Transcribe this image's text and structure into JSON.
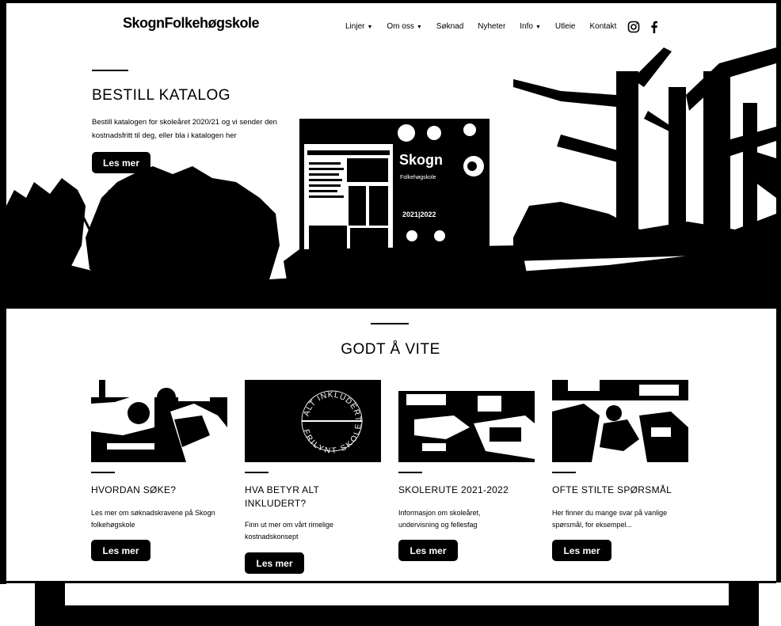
{
  "header": {
    "logo": "SkognFolkehøgskole",
    "nav": [
      {
        "label": "Linjer",
        "dropdown": true
      },
      {
        "label": "Om oss",
        "dropdown": true
      },
      {
        "label": "Søknad",
        "dropdown": false
      },
      {
        "label": "Nyheter",
        "dropdown": false
      },
      {
        "label": "Info",
        "dropdown": true
      },
      {
        "label": "Utleie",
        "dropdown": false
      },
      {
        "label": "Kontakt",
        "dropdown": false
      }
    ],
    "social": [
      "instagram-icon",
      "facebook-icon"
    ]
  },
  "hero": {
    "title": "BESTILL KATALOG",
    "text": "Bestill katalogen for skoleåret 2020/21 og vi sender den kostnadsfritt til deg, eller bla i katalogen her",
    "button": "Les mer",
    "catalog": {
      "title": "Skogn",
      "subtitle": "Folkehøgskole",
      "year": "2021|2022"
    }
  },
  "section": {
    "title": "GODT Å VITE",
    "badge_top": "ALT INKLUDERT",
    "badge_bottom": "FRILYNT SKOLE",
    "cards": [
      {
        "title": "HVORDAN SØKE?",
        "text": "Les mer om søknadskravene på Skogn folkehøgskole",
        "button": "Les mer"
      },
      {
        "title": "HVA BETYR ALT INKLUDERT?",
        "text": "Finn ut mer om vårt rimelige kostnadskonsept",
        "button": "Les mer"
      },
      {
        "title": "SKOLERUTE 2021-2022",
        "text": "Informasjon om skoleåret, undervisning og fellesfag",
        "button": "Les mer"
      },
      {
        "title": "OFTE STILTE SPØRSMÅL",
        "text": "Her finner du mange svar på vanlige spørsmål, for eksempel...",
        "button": "Les mer"
      }
    ]
  },
  "colors": {
    "primary": "#000000",
    "background": "#ffffff"
  }
}
